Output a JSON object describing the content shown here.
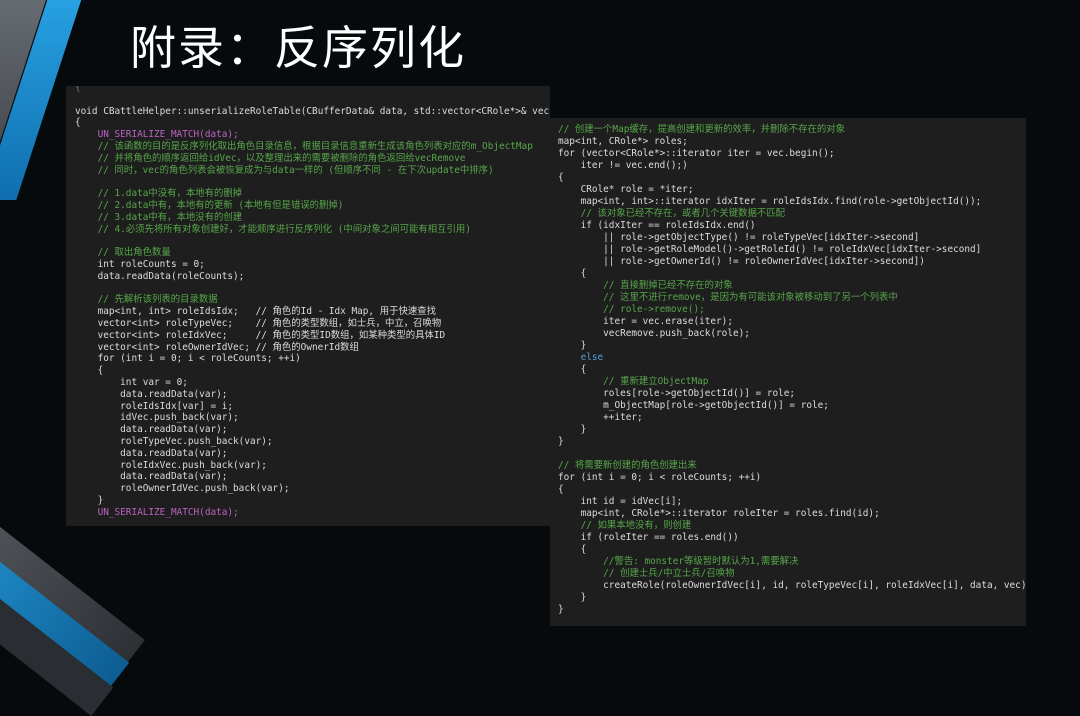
{
  "title": "附录：反序列化",
  "code_left": {
    "lines": [
      {
        "text": "{",
        "cls": "c-faint"
      },
      {
        "text": "",
        "cls": "c-plain"
      },
      {
        "text": "void CBattleHelper::unserializeRoleTable(CBufferData& data, std::vector<CRole*>& vec, std::vector<CRole*>& vecRemove, std::vector<int>& idVec)",
        "cls": "c-plain"
      },
      {
        "text": "{",
        "cls": "c-plain"
      },
      {
        "text": "    UN_SERIALIZE_MATCH(data);",
        "cls": "c-macro"
      },
      {
        "text": "    // 该函数的目的是反序列化取出角色目录信息，根据目录信息重新生成该角色列表对应的m_ObjectMap",
        "cls": "c-comment"
      },
      {
        "text": "    // 并将角色的顺序返回给idVec，以及整理出来的需要被删除的角色返回给vecRemove",
        "cls": "c-comment"
      },
      {
        "text": "    // 同时，vec的角色列表会被恢复成为与data一样的 (但顺序不同 - 在下次update中排序)",
        "cls": "c-comment"
      },
      {
        "text": "",
        "cls": "c-plain"
      },
      {
        "text": "    // 1.data中没有，本地有的删掉",
        "cls": "c-comment"
      },
      {
        "text": "    // 2.data中有，本地有的更新 (本地有但是错误的删掉)",
        "cls": "c-comment"
      },
      {
        "text": "    // 3.data中有，本地没有的创建",
        "cls": "c-comment"
      },
      {
        "text": "    // 4.必须先将所有对象创建好，才能顺序进行反序列化 (中间对象之间可能有相互引用)",
        "cls": "c-comment"
      },
      {
        "text": "",
        "cls": "c-plain"
      },
      {
        "text": "    // 取出角色数量",
        "cls": "c-comment"
      },
      {
        "text": "    int roleCounts = 0;",
        "cls": "c-plain"
      },
      {
        "text": "    data.readData(roleCounts);",
        "cls": "c-plain"
      },
      {
        "text": "",
        "cls": "c-plain"
      },
      {
        "text": "    // 先解析该列表的目录数据",
        "cls": "c-comment"
      },
      {
        "text": "    map<int, int> roleIdsIdx;   // 角色的Id - Idx Map, 用于快速查找",
        "cls": "c-plain"
      },
      {
        "text": "    vector<int> roleTypeVec;    // 角色的类型数组，如士兵，中立，召唤物",
        "cls": "c-plain"
      },
      {
        "text": "    vector<int> roleIdxVec;     // 角色的类型ID数组，如某种类型的具体ID",
        "cls": "c-plain"
      },
      {
        "text": "    vector<int> roleOwnerIdVec; // 角色的OwnerId数组",
        "cls": "c-plain"
      },
      {
        "text": "    for (int i = 0; i < roleCounts; ++i)",
        "cls": "c-plain"
      },
      {
        "text": "    {",
        "cls": "c-plain"
      },
      {
        "text": "        int var = 0;",
        "cls": "c-plain"
      },
      {
        "text": "        data.readData(var);",
        "cls": "c-plain"
      },
      {
        "text": "        roleIdsIdx[var] = i;",
        "cls": "c-plain"
      },
      {
        "text": "        idVec.push_back(var);",
        "cls": "c-plain"
      },
      {
        "text": "        data.readData(var);",
        "cls": "c-plain"
      },
      {
        "text": "        roleTypeVec.push_back(var);",
        "cls": "c-plain"
      },
      {
        "text": "        data.readData(var);",
        "cls": "c-plain"
      },
      {
        "text": "        roleIdxVec.push_back(var);",
        "cls": "c-plain"
      },
      {
        "text": "        data.readData(var);",
        "cls": "c-plain"
      },
      {
        "text": "        roleOwnerIdVec.push_back(var);",
        "cls": "c-plain"
      },
      {
        "text": "    }",
        "cls": "c-plain"
      },
      {
        "text": "    UN_SERIALIZE_MATCH(data);",
        "cls": "c-macro"
      }
    ]
  },
  "code_right": {
    "lines": [
      {
        "text": "// 创建一个Map缓存，提高创建和更新的效率，并删除不存在的对象",
        "cls": "c-comment"
      },
      {
        "text": "map<int, CRole*> roles;",
        "cls": "c-plain"
      },
      {
        "text": "for (vector<CRole*>::iterator iter = vec.begin();",
        "cls": "c-plain"
      },
      {
        "text": "    iter != vec.end();)",
        "cls": "c-plain"
      },
      {
        "text": "{",
        "cls": "c-plain"
      },
      {
        "text": "    CRole* role = *iter;",
        "cls": "c-plain"
      },
      {
        "text": "    map<int, int>::iterator idxIter = roleIdsIdx.find(role->getObjectId());",
        "cls": "c-plain"
      },
      {
        "text": "    // 该对象已经不存在，或者几个关键数据不匹配",
        "cls": "c-comment"
      },
      {
        "text": "    if (idxIter == roleIdsIdx.end()",
        "cls": "c-plain"
      },
      {
        "text": "        || role->getObjectType() != roleTypeVec[idxIter->second]",
        "cls": "c-plain"
      },
      {
        "text": "        || role->getRoleModel()->getRoleId() != roleIdxVec[idxIter->second]",
        "cls": "c-plain"
      },
      {
        "text": "        || role->getOwnerId() != roleOwnerIdVec[idxIter->second])",
        "cls": "c-plain"
      },
      {
        "text": "    {",
        "cls": "c-plain"
      },
      {
        "text": "        // 直接删掉已经不存在的对象",
        "cls": "c-comment"
      },
      {
        "text": "        // 这里不进行remove，是因为有可能该对象被移动到了另一个列表中",
        "cls": "c-comment"
      },
      {
        "text": "        // role->remove();",
        "cls": "c-comment"
      },
      {
        "text": "        iter = vec.erase(iter);",
        "cls": "c-plain"
      },
      {
        "text": "        vecRemove.push_back(role);",
        "cls": "c-plain"
      },
      {
        "text": "    }",
        "cls": "c-plain"
      },
      {
        "text": "    else",
        "cls": "c-keyword"
      },
      {
        "text": "    {",
        "cls": "c-plain"
      },
      {
        "text": "        // 重新建立ObjectMap",
        "cls": "c-comment"
      },
      {
        "text": "        roles[role->getObjectId()] = role;",
        "cls": "c-plain"
      },
      {
        "text": "        m_ObjectMap[role->getObjectId()] = role;",
        "cls": "c-plain"
      },
      {
        "text": "        ++iter;",
        "cls": "c-plain"
      },
      {
        "text": "    }",
        "cls": "c-plain"
      },
      {
        "text": "}",
        "cls": "c-plain"
      },
      {
        "text": "",
        "cls": "c-plain"
      },
      {
        "text": "// 将需要新创建的角色创建出来",
        "cls": "c-comment"
      },
      {
        "text": "for (int i = 0; i < roleCounts; ++i)",
        "cls": "c-plain"
      },
      {
        "text": "{",
        "cls": "c-plain"
      },
      {
        "text": "    int id = idVec[i];",
        "cls": "c-plain"
      },
      {
        "text": "    map<int, CRole*>::iterator roleIter = roles.find(id);",
        "cls": "c-plain"
      },
      {
        "text": "    // 如果本地没有，则创建",
        "cls": "c-comment"
      },
      {
        "text": "    if (roleIter == roles.end())",
        "cls": "c-plain"
      },
      {
        "text": "    {",
        "cls": "c-plain"
      },
      {
        "text": "        //警告: monster等级暂时默认为1,需要解决",
        "cls": "c-comment"
      },
      {
        "text": "        // 创建士兵/中立士兵/召唤物",
        "cls": "c-comment"
      },
      {
        "text": "        createRole(roleOwnerIdVec[i], id, roleTypeVec[i], roleIdxVec[i], data, vec);",
        "cls": "c-plain"
      },
      {
        "text": "    }",
        "cls": "c-plain"
      },
      {
        "text": "}",
        "cls": "c-plain"
      }
    ]
  }
}
